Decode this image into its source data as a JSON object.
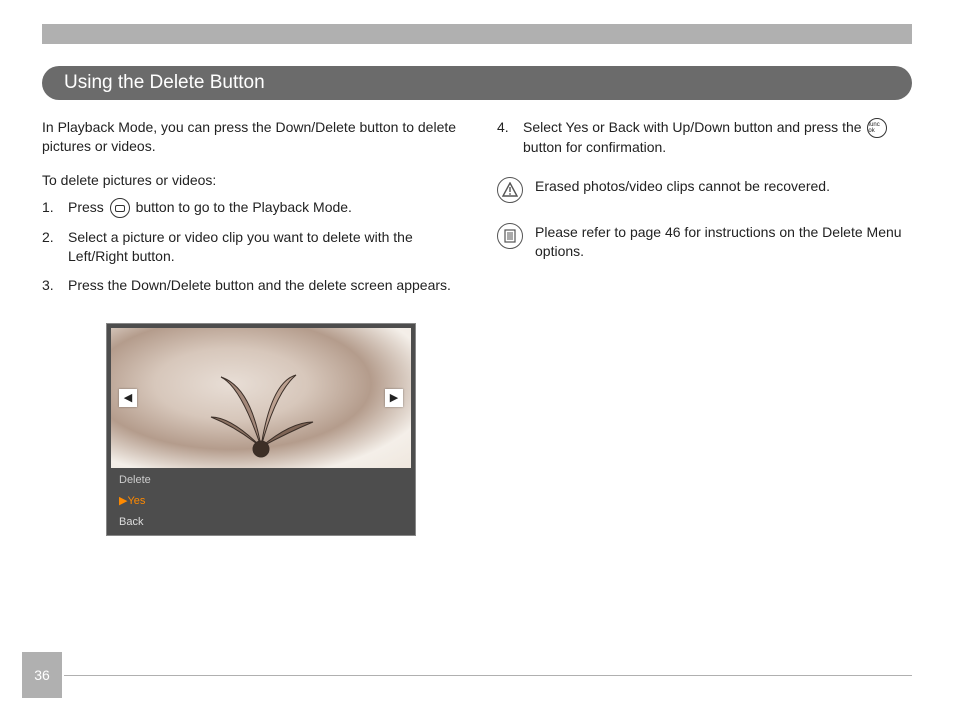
{
  "section_title": "Using the Delete Button",
  "left": {
    "intro": "In Playback Mode, you can press the Down/Delete button to delete pictures or videos.",
    "intro2": "To delete pictures or videos:",
    "steps": [
      {
        "num": "1.",
        "pre": "Press",
        "post": "button to go to the Playback Mode."
      },
      {
        "num": "2.",
        "text": "Select a picture or video clip you want to delete with the Left/Right button."
      },
      {
        "num": "3.",
        "text": "Press the Down/Delete button and the delete screen appears."
      }
    ],
    "camera": {
      "delete_label": "Delete",
      "yes": "▶Yes",
      "back": "Back",
      "left_arrow": "◀",
      "right_arrow": "▶"
    }
  },
  "right": {
    "step4": {
      "num": "4.",
      "pre": "Select Yes or Back with Up/Down button and press the",
      "post": "button for conﬁrmation."
    },
    "warn": "Erased photos/video clips cannot be recovered.",
    "ref": "Please refer to page 46 for instructions on the Delete Menu options."
  },
  "page_number": "36",
  "icons": {
    "func_ok": "func ok"
  }
}
